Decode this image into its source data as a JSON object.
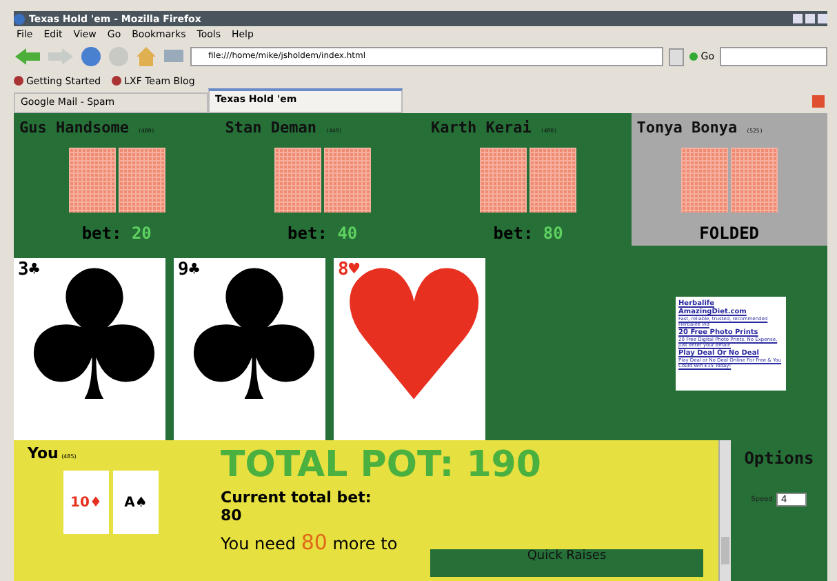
{
  "window": {
    "title": "Texas Hold 'em - Mozilla Firefox"
  },
  "menu": [
    "File",
    "Edit",
    "View",
    "Go",
    "Bookmarks",
    "Tools",
    "Help"
  ],
  "address": {
    "value": "file:///home/mike/jsholdem/index.html"
  },
  "go": "Go",
  "bookmarks": [
    "Getting Started",
    "LXF Team Blog"
  ],
  "tabs": [
    {
      "label": "Google Mail - Spam",
      "selected": false
    },
    {
      "label": "Texas Hold 'em",
      "selected": true
    }
  ],
  "players": [
    {
      "name": "Gus Handsome",
      "chips": "(480)",
      "folded": false,
      "bet_label": "bet:",
      "bet": "20"
    },
    {
      "name": "Stan Deman",
      "chips": "(440)",
      "folded": false,
      "bet_label": "bet:",
      "bet": "40"
    },
    {
      "name": "Karth Kerai",
      "chips": "(400)",
      "folded": false,
      "bet_label": "bet:",
      "bet": "80"
    },
    {
      "name": "Tonya Bonya",
      "chips": "(525)",
      "folded": true,
      "status": "FOLDED"
    }
  ],
  "board": [
    {
      "rank": "3",
      "suit": "♣",
      "red": false
    },
    {
      "rank": "9",
      "suit": "♣",
      "red": false
    },
    {
      "rank": "8",
      "suit": "♥",
      "red": true
    }
  ],
  "ads": [
    {
      "title": "Herbalife AmazingDiet.com",
      "text": "Fast, reliable, trusted, recommended Herbalife ind"
    },
    {
      "title": "20 Free Photo Prints",
      "text": "20 Free Digital Photo Prints. No Expense, just enter your email!"
    },
    {
      "title": "Play Deal Or No Deal",
      "text": "Play Deal or No Deal Online For Free & You Could Win £15 Today!"
    }
  ],
  "you": {
    "name": "You",
    "chips": "(485)",
    "cards": [
      {
        "rank": "10",
        "suit": "♦",
        "red": true
      },
      {
        "rank": "A",
        "suit": "♠",
        "red": false
      }
    ]
  },
  "pot": "TOTAL POT: 190",
  "current_bet": {
    "label": "Current total bet:",
    "value": "80"
  },
  "need": {
    "before": "You need",
    "amount": "80",
    "after": "more to"
  },
  "quick_raises": "Quick Raises",
  "options": {
    "title": "Options",
    "speed_label": "Speed",
    "speed": "4"
  }
}
